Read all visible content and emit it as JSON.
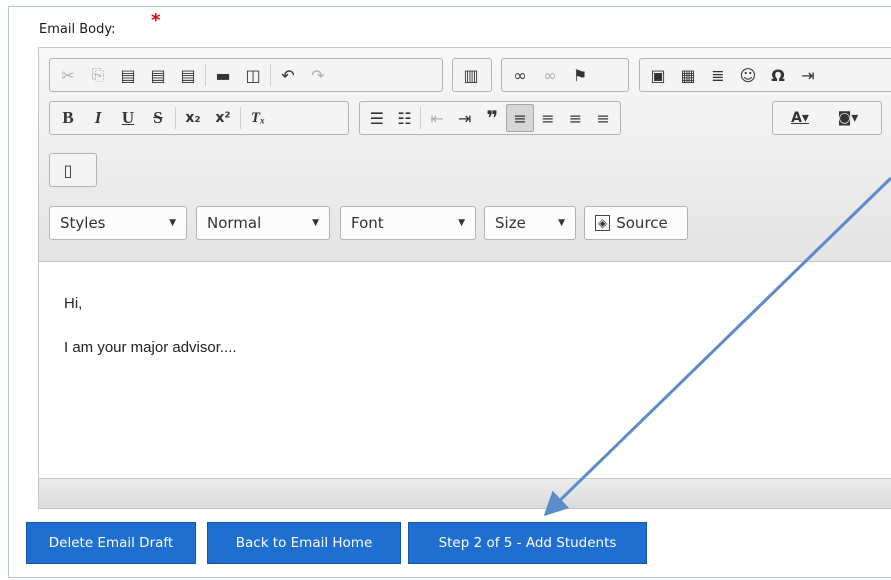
{
  "form": {
    "label": "Email Body:",
    "required_mark": "*"
  },
  "toolbar": {
    "row1": [
      {
        "icon": "cut-icon",
        "glyph": "✂"
      },
      {
        "icon": "copy-icon",
        "glyph": "⎘"
      },
      {
        "icon": "paste-icon",
        "glyph": "📋"
      },
      {
        "icon": "paste-text-icon",
        "glyph": "📋"
      },
      {
        "icon": "paste-word-icon",
        "glyph": "📋"
      },
      {
        "icon": "print-icon",
        "glyph": "🖶"
      },
      {
        "icon": "preview-icon",
        "glyph": "🔍"
      },
      {
        "icon": "undo-icon",
        "glyph": "↶"
      },
      {
        "icon": "redo-icon",
        "glyph": "↷"
      },
      {
        "icon": "templates-icon",
        "glyph": "▤"
      },
      {
        "icon": "link-icon",
        "glyph": "🔗"
      },
      {
        "icon": "unlink-icon",
        "glyph": "⛓"
      },
      {
        "icon": "anchor-icon",
        "glyph": "⚑"
      },
      {
        "icon": "image-icon",
        "glyph": "🖾"
      },
      {
        "icon": "table-icon",
        "glyph": "▦"
      },
      {
        "icon": "horizontal-rule-icon",
        "glyph": "≣"
      },
      {
        "icon": "smiley-icon",
        "glyph": "☺"
      },
      {
        "icon": "special-char-icon",
        "glyph": "Ω"
      },
      {
        "icon": "indent-icon",
        "glyph": "⇥"
      }
    ],
    "row2": [
      {
        "icon": "bold-icon",
        "glyph": "B"
      },
      {
        "icon": "italic-icon",
        "glyph": "I"
      },
      {
        "icon": "underline-icon",
        "glyph": "U"
      },
      {
        "icon": "strikethrough-icon",
        "glyph": "S"
      },
      {
        "icon": "subscript-icon",
        "glyph": "x₂"
      },
      {
        "icon": "superscript-icon",
        "glyph": "x²"
      },
      {
        "icon": "remove-format-icon",
        "glyph": "Tₓ"
      },
      {
        "icon": "numbered-list-icon",
        "glyph": "⒈"
      },
      {
        "icon": "bulleted-list-icon",
        "glyph": "•"
      },
      {
        "icon": "outdent-icon",
        "glyph": "⇤"
      },
      {
        "icon": "indent-icon",
        "glyph": "⇥"
      },
      {
        "icon": "blockquote-icon",
        "glyph": "❞"
      },
      {
        "icon": "align-left-icon",
        "glyph": "≡"
      },
      {
        "icon": "align-center-icon",
        "glyph": "≡"
      },
      {
        "icon": "align-right-icon",
        "glyph": "≡"
      },
      {
        "icon": "justify-icon",
        "glyph": "≡"
      },
      {
        "icon": "text-color-icon",
        "glyph": "A▾"
      },
      {
        "icon": "background-color-icon",
        "glyph": "🅰▾"
      }
    ],
    "maximize_icon": "maximize-icon",
    "styles_label": "Styles",
    "format_label": "Normal",
    "font_label": "Font",
    "size_label": "Size",
    "source_label": "Source"
  },
  "content": {
    "line1": "Hi,",
    "line2": "I am your major advisor...."
  },
  "buttons": {
    "delete": "Delete Email Draft",
    "back": "Back to Email Home",
    "next": "Step 2 of 5 - Add Students"
  },
  "colors": {
    "button_bg": "#1f6fd1",
    "required_star": "#e0000f",
    "annotation_arrow": "#5b8cc9"
  }
}
